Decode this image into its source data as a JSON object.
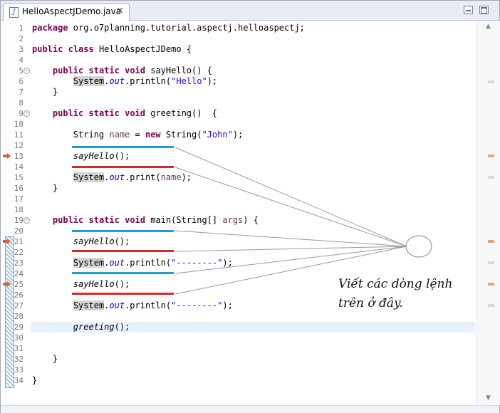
{
  "tab": {
    "title": "HelloAspectJDemo.java",
    "icon": "java-file-icon"
  },
  "code_lines": [
    {
      "n": "1",
      "parts": [
        {
          "t": "package",
          "c": "kw"
        },
        {
          "t": " org.o7planning.tutorial.aspectj.helloaspectj;"
        }
      ]
    },
    {
      "n": "2",
      "parts": []
    },
    {
      "n": "3",
      "parts": [
        {
          "t": "public",
          "c": "kw"
        },
        {
          "t": " "
        },
        {
          "t": "class",
          "c": "kw"
        },
        {
          "t": " HelloAspectJDemo {"
        }
      ]
    },
    {
      "n": "4",
      "parts": []
    },
    {
      "n": "5",
      "fold": true,
      "parts": [
        {
          "t": "    "
        },
        {
          "t": "public",
          "c": "kw"
        },
        {
          "t": " "
        },
        {
          "t": "static",
          "c": "kw"
        },
        {
          "t": " "
        },
        {
          "t": "void",
          "c": "kw"
        },
        {
          "t": " sayHello() {"
        }
      ]
    },
    {
      "n": "6",
      "parts": [
        {
          "t": "        "
        },
        {
          "t": "System",
          "c": "hl"
        },
        {
          "t": "."
        },
        {
          "t": "out",
          "c": "fld"
        },
        {
          "t": ".println("
        },
        {
          "t": "\"Hello\"",
          "c": "str"
        },
        {
          "t": ");"
        }
      ]
    },
    {
      "n": "7",
      "parts": [
        {
          "t": "    }"
        }
      ]
    },
    {
      "n": "8",
      "parts": []
    },
    {
      "n": "9",
      "fold": true,
      "parts": [
        {
          "t": "    "
        },
        {
          "t": "public",
          "c": "kw"
        },
        {
          "t": " "
        },
        {
          "t": "static",
          "c": "kw"
        },
        {
          "t": " "
        },
        {
          "t": "void",
          "c": "kw"
        },
        {
          "t": " greeting()  {"
        }
      ]
    },
    {
      "n": "10",
      "parts": []
    },
    {
      "n": "11",
      "parts": [
        {
          "t": "        String "
        },
        {
          "t": "name",
          "c": "var"
        },
        {
          "t": " = "
        },
        {
          "t": "new",
          "c": "kw"
        },
        {
          "t": " String("
        },
        {
          "t": "\"John\"",
          "c": "str"
        },
        {
          "t": ");"
        }
      ]
    },
    {
      "n": "12",
      "parts": []
    },
    {
      "n": "13",
      "marker": true,
      "parts": [
        {
          "t": "        "
        },
        {
          "t": "sayHello",
          "c": "itl"
        },
        {
          "t": "();"
        }
      ]
    },
    {
      "n": "14",
      "parts": []
    },
    {
      "n": "15",
      "parts": [
        {
          "t": "        "
        },
        {
          "t": "System",
          "c": "hl"
        },
        {
          "t": "."
        },
        {
          "t": "out",
          "c": "fld"
        },
        {
          "t": ".print("
        },
        {
          "t": "name",
          "c": "var"
        },
        {
          "t": ");"
        }
      ]
    },
    {
      "n": "16",
      "parts": [
        {
          "t": "    }"
        }
      ]
    },
    {
      "n": "17",
      "parts": []
    },
    {
      "n": "18",
      "parts": []
    },
    {
      "n": "19",
      "fold": true,
      "parts": [
        {
          "t": "    "
        },
        {
          "t": "public",
          "c": "kw"
        },
        {
          "t": " "
        },
        {
          "t": "static",
          "c": "kw"
        },
        {
          "t": " "
        },
        {
          "t": "void",
          "c": "kw"
        },
        {
          "t": " main(String[] "
        },
        {
          "t": "args",
          "c": "var"
        },
        {
          "t": ") {"
        }
      ]
    },
    {
      "n": "20",
      "parts": []
    },
    {
      "n": "21",
      "marker": true,
      "parts": [
        {
          "t": "        "
        },
        {
          "t": "sayHello",
          "c": "itl"
        },
        {
          "t": "();"
        }
      ]
    },
    {
      "n": "22",
      "parts": []
    },
    {
      "n": "23",
      "parts": [
        {
          "t": "        "
        },
        {
          "t": "System",
          "c": "hl"
        },
        {
          "t": "."
        },
        {
          "t": "out",
          "c": "fld"
        },
        {
          "t": ".println("
        },
        {
          "t": "\"--------\"",
          "c": "str"
        },
        {
          "t": ");"
        }
      ]
    },
    {
      "n": "24",
      "parts": []
    },
    {
      "n": "25",
      "marker": true,
      "parts": [
        {
          "t": "        "
        },
        {
          "t": "sayHello",
          "c": "itl"
        },
        {
          "t": "();"
        }
      ]
    },
    {
      "n": "26",
      "parts": []
    },
    {
      "n": "27",
      "parts": [
        {
          "t": "        "
        },
        {
          "t": "System",
          "c": "hl"
        },
        {
          "t": "."
        },
        {
          "t": "out",
          "c": "fld"
        },
        {
          "t": ".println("
        },
        {
          "t": "\"--------\"",
          "c": "str"
        },
        {
          "t": ");"
        }
      ]
    },
    {
      "n": "28",
      "parts": []
    },
    {
      "n": "29",
      "current": true,
      "parts": [
        {
          "t": "        "
        },
        {
          "t": "greeting",
          "c": "itl"
        },
        {
          "t": "();"
        }
      ]
    },
    {
      "n": "30",
      "parts": []
    },
    {
      "n": "31",
      "parts": []
    },
    {
      "n": "32",
      "parts": [
        {
          "t": "    }"
        }
      ]
    },
    {
      "n": "33",
      "parts": []
    },
    {
      "n": "34",
      "parts": [
        {
          "t": "}"
        }
      ]
    }
  ],
  "annotation": {
    "note_line1": "Viết các dòng lệnh",
    "note_line2": "trên ở đây.",
    "blue": "#1e9bd7",
    "red": "#d42a2a"
  },
  "colors": {
    "keyword": "#7f0055",
    "string": "#2a00ff",
    "field": "#0000c0",
    "local_var": "#6a3e3e",
    "current_line": "#e8f2fe"
  }
}
